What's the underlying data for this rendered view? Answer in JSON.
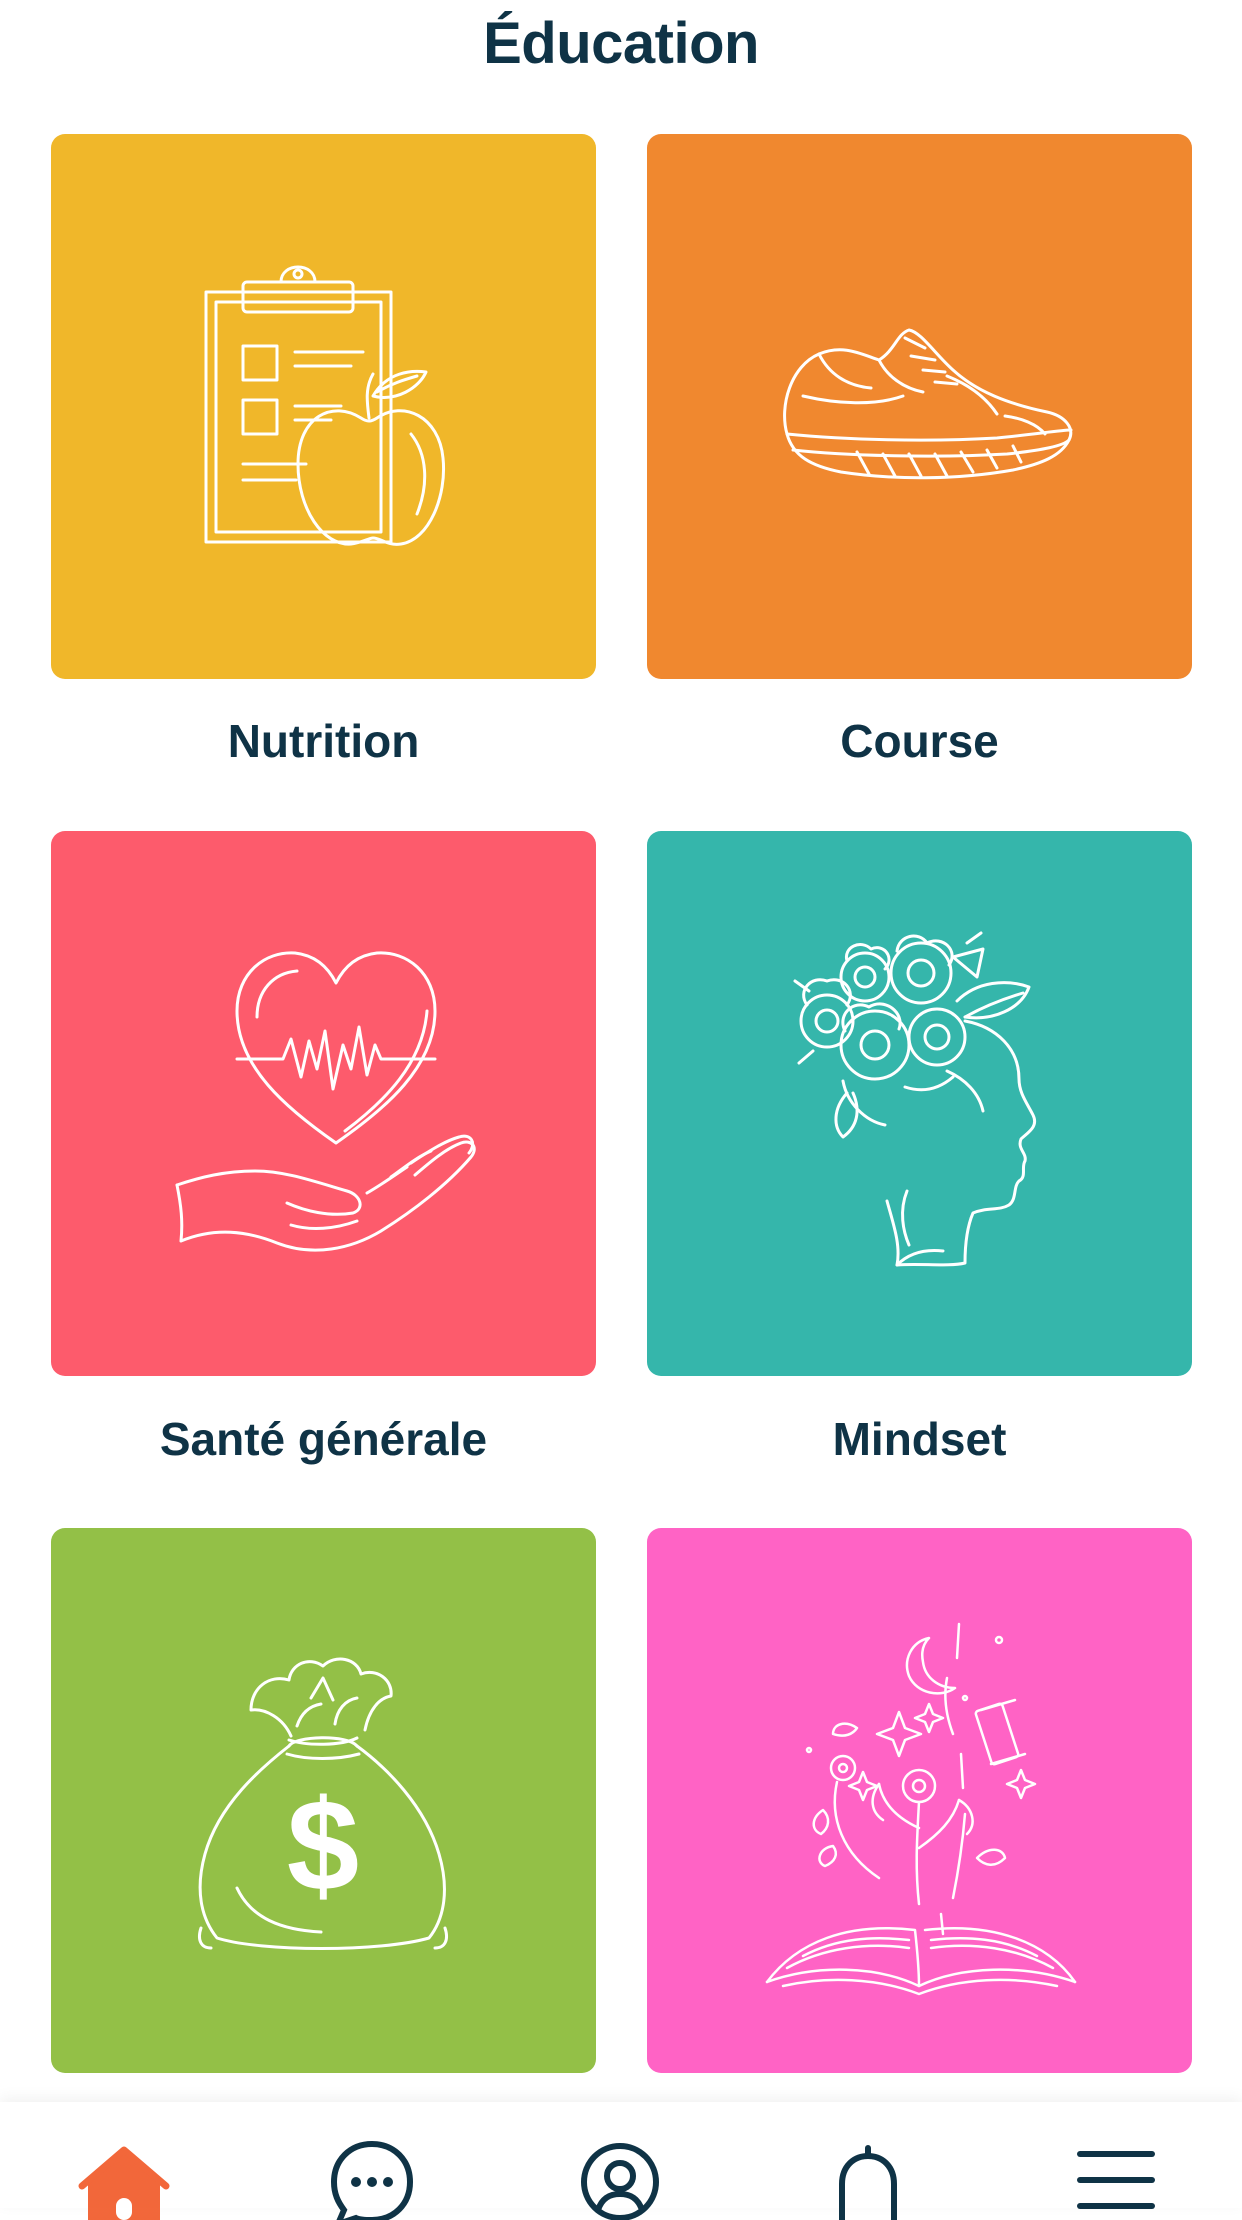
{
  "header": {
    "title": "Éducation"
  },
  "categories": [
    {
      "label": "Nutrition",
      "color": "#f0b72a",
      "icon": "clipboard-apple-icon"
    },
    {
      "label": "Course",
      "color": "#f0882f",
      "icon": "running-shoe-icon"
    },
    {
      "label": "Santé générale",
      "color": "#fd5b6c",
      "icon": "heart-hand-icon"
    },
    {
      "label": "Mindset",
      "color": "#35b6ab",
      "icon": "flower-head-icon"
    },
    {
      "label": "",
      "color": "#93c047",
      "icon": "money-bag-icon"
    },
    {
      "label": "",
      "color": "#ff63c5",
      "icon": "open-book-moon-icon"
    }
  ],
  "tabbar": {
    "items": [
      {
        "icon": "home-icon",
        "active": true
      },
      {
        "icon": "chat-icon",
        "active": false
      },
      {
        "icon": "profile-icon",
        "active": false
      },
      {
        "icon": "bell-icon",
        "active": false
      },
      {
        "icon": "menu-icon",
        "active": false
      }
    ],
    "active_color": "#f2673a",
    "inactive_color": "#0f3346"
  }
}
